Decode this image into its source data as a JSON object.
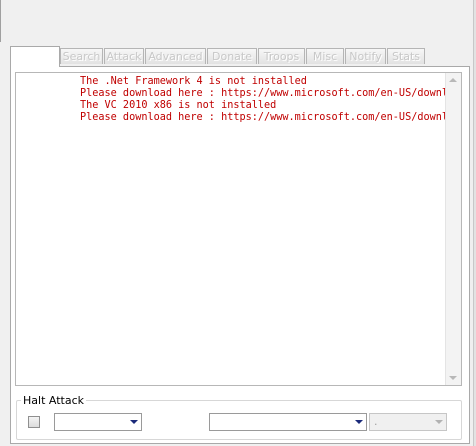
{
  "tabs": [
    {
      "label": ""
    },
    {
      "label": "Search"
    },
    {
      "label": "Attack"
    },
    {
      "label": "Advanced"
    },
    {
      "label": "Donate"
    },
    {
      "label": "Troops"
    },
    {
      "label": "Misc"
    },
    {
      "label": "Notify"
    },
    {
      "label": "Stats"
    }
  ],
  "log": {
    "color": "#c00000",
    "lines": [
      "The .Net Framework 4 is not installed",
      "Please download here : https://www.microsoft.com/en-US/downlo",
      "The VC 2010 x86 is not installed",
      "Please download here : https://www.microsoft.com/en-US/downlo"
    ]
  },
  "halt_attack": {
    "title": "Halt Attack",
    "checkbox_checked": false,
    "combo1_value": "",
    "combo2_value": "",
    "combo3_value": "."
  },
  "icons": {
    "scroll_up": "scroll-up-arrow-icon",
    "scroll_down": "scroll-down-arrow-icon",
    "dropdown": "chevron-down-icon"
  }
}
